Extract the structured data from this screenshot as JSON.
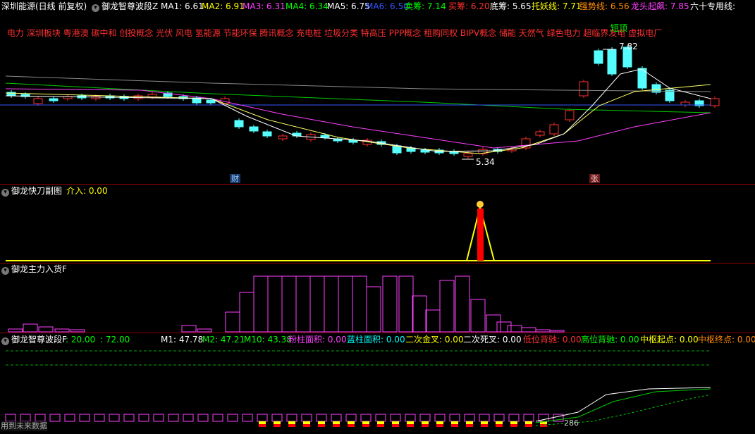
{
  "header": {
    "title": "深圳能源(日线 前复权)",
    "indicator": "御龙智尊波段Z",
    "items": [
      {
        "label": "MA1: 6.61",
        "color": "#ffffff"
      },
      {
        "label": "MA2: 6.91",
        "color": "#ffff00"
      },
      {
        "label": "MA3: 6.31",
        "color": "#ff40ff"
      },
      {
        "label": "MA4: 6.34",
        "color": "#00ff00"
      },
      {
        "label": "MA5: 6.75",
        "color": "#ffffff"
      },
      {
        "label": "MA6: 6.50",
        "color": "#3355ff"
      },
      {
        "label": "卖筹: 7.14",
        "color": "#00ff00"
      },
      {
        "label": "买筹: 6.20",
        "color": "#ff3030"
      },
      {
        "label": "底筹: 5.65",
        "color": "#ffffff"
      },
      {
        "label": "托妖线: 7.71",
        "color": "#ffff00"
      },
      {
        "label": "强势线: 6.56",
        "color": "#ff8c00"
      },
      {
        "label": "龙头起飙: 7.85",
        "color": "#ff40ff"
      },
      {
        "label": "六十专用线: ",
        "color": "#ffffff"
      }
    ]
  },
  "concepts": "电力 深圳板块 粤港澳 碳中和 创投概念 光伏 风电 氢能源 节能环保 腾讯概念 充电桩 垃圾分类 特高压 PPP概念 租购同权 BIPV概念 储能 天然气 绿色电力 超临界发电 虚拟电厂",
  "main_chart": {
    "high_label": "7.82",
    "low_label": "5.34",
    "tag_short": "短顶",
    "marker_cai": "财",
    "marker_zhang": "张"
  },
  "panel2": {
    "title": "御龙快刀副图",
    "items": [
      {
        "label": "介入: 0.00",
        "color": "#ffff00"
      }
    ]
  },
  "panel3": {
    "title": "御龙主力入货F"
  },
  "panel4": {
    "title": "御龙智尊波段F",
    "items": [
      {
        "label": ": 20.00",
        "color": "#00ff00"
      },
      {
        "label": ": 72.00",
        "color": "#00ff00"
      },
      {
        "label": "M1: 47.78",
        "color": "#ffffff"
      },
      {
        "label": "M2: 47.21",
        "color": "#00ff00"
      },
      {
        "label": "M10: 43.38",
        "color": "#00ff00"
      },
      {
        "label": "粉柱面积: 0.00",
        "color": "#ff40ff"
      },
      {
        "label": "蓝柱面积: 0.00",
        "color": "#00ffff"
      },
      {
        "label": "二次金叉: 0.00",
        "color": "#ffff00"
      },
      {
        "label": "二次死叉: 0.00",
        "color": "#ffffff"
      },
      {
        "label": "低位背驰: 0.00",
        "color": "#ff3030"
      },
      {
        "label": "高位背驰: 0.00",
        "color": "#00ff00"
      },
      {
        "label": "中枢起点: 0.00",
        "color": "#ffff00"
      },
      {
        "label": "中枢终点: 0.00",
        "color": "#ff8c00"
      }
    ],
    "value_286": "286"
  },
  "footer": "用到未来数据"
}
